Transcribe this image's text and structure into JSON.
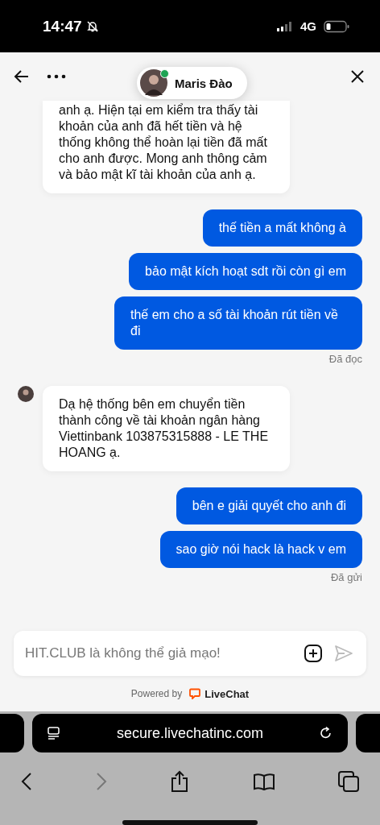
{
  "status_bar": {
    "time": "14:47",
    "network": "4G"
  },
  "header": {
    "agent_name": "Maris Đào",
    "online": true
  },
  "messages": [
    {
      "kind": "agent",
      "text": "anh ạ. Hiện tại em kiểm tra thấy tài khoản của anh đã hết tiền và hệ thống không thể hoàn lại tiền đã mất cho anh được. Mong anh thông cảm và bảo mật kĩ tài khoản của anh ạ."
    },
    {
      "kind": "visitor",
      "text": "thế tiền a mất không à"
    },
    {
      "kind": "visitor",
      "text": "bảo mật kích hoạt sdt rồi còn gì em"
    },
    {
      "kind": "visitor",
      "text": "thế em cho a số tài khoản rút tiền về đi"
    },
    {
      "kind": "status",
      "text": "Đã đọc"
    },
    {
      "kind": "agent",
      "text": "Dạ hệ thống bên em chuyển tiền thành công về tài khoản ngân hàng Viettinbank 103875315888 - LE THE HOANG ạ.",
      "avatar": true
    },
    {
      "kind": "visitor",
      "text": "bên e giải quyết cho anh đi"
    },
    {
      "kind": "visitor",
      "text": "sao giờ nói hack là hack v em"
    },
    {
      "kind": "status",
      "text": "Đã gửi"
    }
  ],
  "composer": {
    "placeholder": "HIT.CLUB là không thể giả mạo!"
  },
  "footer": {
    "powered_by": "Powered by",
    "brand": "LiveChat"
  },
  "browser": {
    "url": "secure.livechatinc.com",
    "back_disabled": false,
    "forward_disabled": true
  }
}
